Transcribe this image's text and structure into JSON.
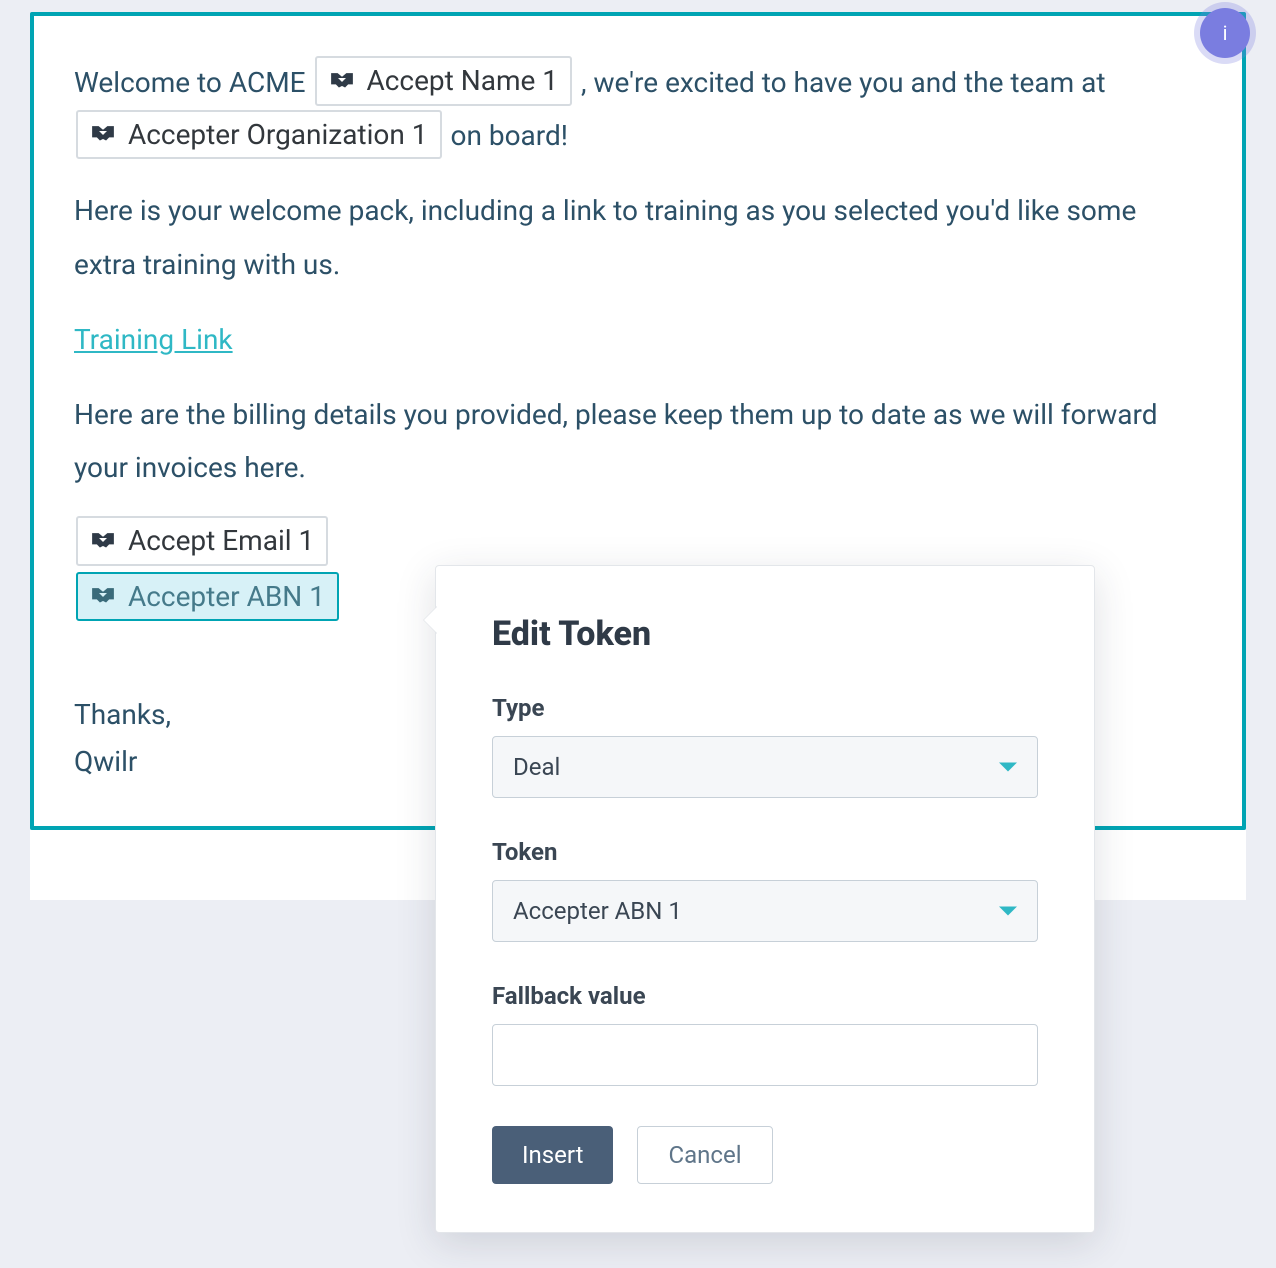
{
  "info_badge": "i",
  "body": {
    "welcome_prefix": "Welcome to ACME ",
    "token_accept_name": "Accept Name 1",
    "welcome_mid": ", we're excited to have you and the team at ",
    "token_accepter_org": "Accepter Organization 1",
    "welcome_suffix": " on board!",
    "pack_text": "Here is your welcome pack, including a link to training as you selected you'd like some extra training with us.",
    "training_link": "Training Link",
    "billing_text": "Here are the billing details you provided, please keep them up to date as we will forward your invoices here.",
    "token_accept_email": "Accept Email 1",
    "token_accepter_abn": "Accepter ABN 1",
    "thanks": "Thanks,",
    "signature": "Qwilr"
  },
  "popover": {
    "title": "Edit Token",
    "type_label": "Type",
    "type_value": "Deal",
    "token_label": "Token",
    "token_value": "Accepter ABN 1",
    "fallback_label": "Fallback value",
    "fallback_value": "",
    "insert": "Insert",
    "cancel": "Cancel"
  }
}
